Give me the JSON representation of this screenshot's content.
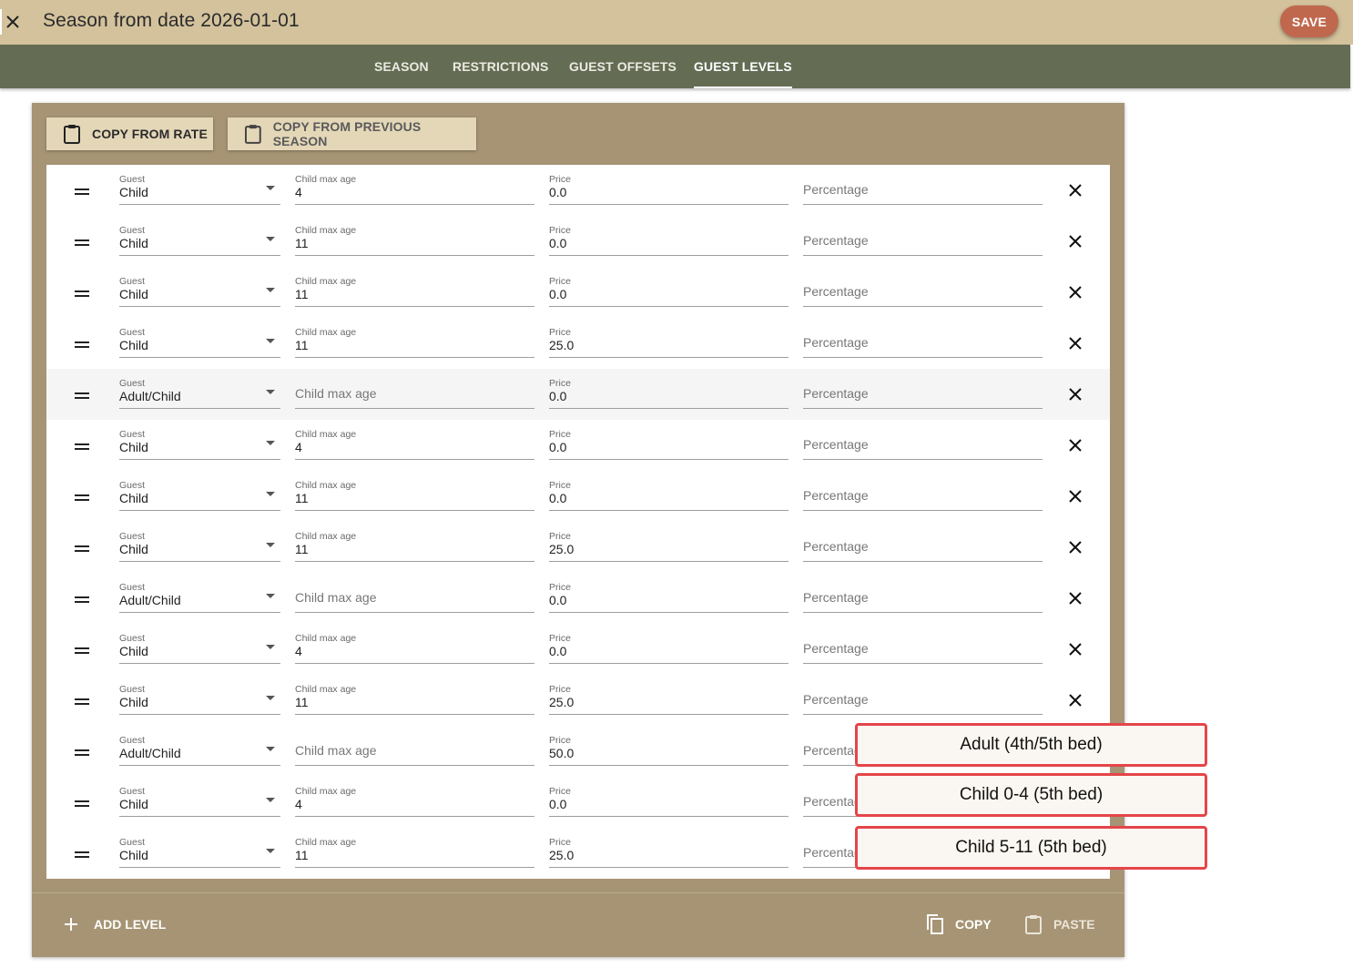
{
  "header": {
    "title": "Season from date 2026-01-01",
    "save_label": "SAVE"
  },
  "tabs": [
    {
      "label": "SEASON",
      "active": false
    },
    {
      "label": "RESTRICTIONS",
      "active": false
    },
    {
      "label": "GUEST OFFSETS",
      "active": false
    },
    {
      "label": "GUEST LEVELS",
      "active": true
    }
  ],
  "toolbar": {
    "copy_from_rate": "COPY FROM RATE",
    "copy_from_previous": "COPY FROM PREVIOUS SEASON"
  },
  "labels": {
    "guest": "Guest",
    "child_max_age": "Child max age",
    "price": "Price",
    "percentage": "Percentage"
  },
  "rows": [
    {
      "guest": "Child",
      "age": "4",
      "price": "0.0",
      "percentage": ""
    },
    {
      "guest": "Child",
      "age": "11",
      "price": "0.0",
      "percentage": ""
    },
    {
      "guest": "Child",
      "age": "11",
      "price": "0.0",
      "percentage": ""
    },
    {
      "guest": "Child",
      "age": "11",
      "price": "25.0",
      "percentage": ""
    },
    {
      "guest": "Adult/Child",
      "age": "",
      "price": "0.0",
      "percentage": "",
      "highlighted": true
    },
    {
      "guest": "Child",
      "age": "4",
      "price": "0.0",
      "percentage": ""
    },
    {
      "guest": "Child",
      "age": "11",
      "price": "0.0",
      "percentage": ""
    },
    {
      "guest": "Child",
      "age": "11",
      "price": "25.0",
      "percentage": ""
    },
    {
      "guest": "Adult/Child",
      "age": "",
      "price": "0.0",
      "percentage": ""
    },
    {
      "guest": "Child",
      "age": "4",
      "price": "0.0",
      "percentage": ""
    },
    {
      "guest": "Child",
      "age": "11",
      "price": "25.0",
      "percentage": ""
    },
    {
      "guest": "Adult/Child",
      "age": "",
      "price": "50.0",
      "percentage": ""
    },
    {
      "guest": "Child",
      "age": "4",
      "price": "0.0",
      "percentage": ""
    },
    {
      "guest": "Child",
      "age": "11",
      "price": "25.0",
      "percentage": ""
    }
  ],
  "footer": {
    "add_level": "ADD LEVEL",
    "copy": "COPY",
    "paste": "PASTE"
  },
  "callouts": [
    "Adult (4th/5th bed)",
    "Child 0-4 (5th bed)",
    "Child 5-11 (5th bed)"
  ],
  "colors": {
    "header_bg": "#d3c29c",
    "tabbar_bg": "#646d54",
    "card_bg": "#a69474",
    "save_bg": "#c0684e",
    "callout_border": "#e4454a"
  }
}
